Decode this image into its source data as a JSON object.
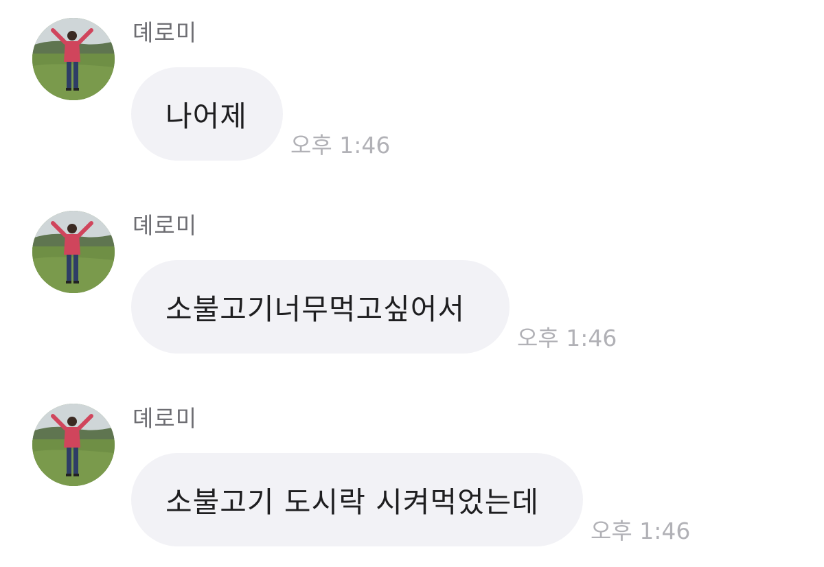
{
  "messages": [
    {
      "sender": "뎨로미",
      "avatar_icon": "profile-photo",
      "text": "나어제",
      "time": "오후 1:46"
    },
    {
      "sender": "뎨로미",
      "avatar_icon": "profile-photo",
      "text": "소불고기너무먹고싶어서",
      "time": "오후 1:46"
    },
    {
      "sender": "뎨로미",
      "avatar_icon": "profile-photo",
      "text": "소불고기 도시락 시켜먹었는데",
      "time": "오후 1:46"
    }
  ],
  "colors": {
    "background": "#ffffff",
    "bubble": "#f2f2f6",
    "sender_name": "#6d6d72",
    "message_text": "#1e1e20",
    "timestamp": "#b1b1b6"
  }
}
